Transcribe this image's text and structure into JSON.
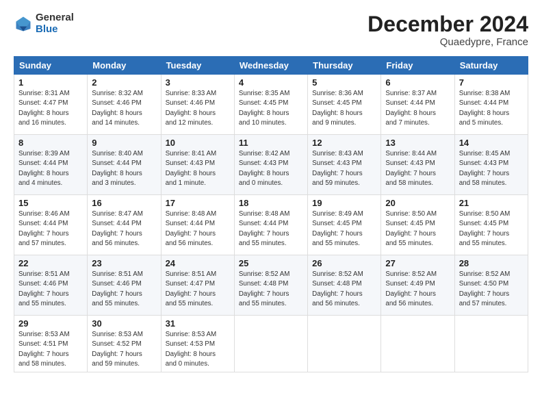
{
  "header": {
    "logo_general": "General",
    "logo_blue": "Blue",
    "month_title": "December 2024",
    "subtitle": "Quaedypre, France"
  },
  "calendar": {
    "days_of_week": [
      "Sunday",
      "Monday",
      "Tuesday",
      "Wednesday",
      "Thursday",
      "Friday",
      "Saturday"
    ],
    "weeks": [
      [
        null,
        null,
        null,
        null,
        null,
        null,
        null
      ]
    ],
    "cells": [
      {
        "day": 1,
        "sunrise": "8:31 AM",
        "sunset": "4:47 PM",
        "daylight": "8 hours and 16 minutes."
      },
      {
        "day": 2,
        "sunrise": "8:32 AM",
        "sunset": "4:46 PM",
        "daylight": "8 hours and 14 minutes."
      },
      {
        "day": 3,
        "sunrise": "8:33 AM",
        "sunset": "4:46 PM",
        "daylight": "8 hours and 12 minutes."
      },
      {
        "day": 4,
        "sunrise": "8:35 AM",
        "sunset": "4:45 PM",
        "daylight": "8 hours and 10 minutes."
      },
      {
        "day": 5,
        "sunrise": "8:36 AM",
        "sunset": "4:45 PM",
        "daylight": "8 hours and 9 minutes."
      },
      {
        "day": 6,
        "sunrise": "8:37 AM",
        "sunset": "4:44 PM",
        "daylight": "8 hours and 7 minutes."
      },
      {
        "day": 7,
        "sunrise": "8:38 AM",
        "sunset": "4:44 PM",
        "daylight": "8 hours and 5 minutes."
      },
      {
        "day": 8,
        "sunrise": "8:39 AM",
        "sunset": "4:44 PM",
        "daylight": "8 hours and 4 minutes."
      },
      {
        "day": 9,
        "sunrise": "8:40 AM",
        "sunset": "4:44 PM",
        "daylight": "8 hours and 3 minutes."
      },
      {
        "day": 10,
        "sunrise": "8:41 AM",
        "sunset": "4:43 PM",
        "daylight": "8 hours and 1 minute."
      },
      {
        "day": 11,
        "sunrise": "8:42 AM",
        "sunset": "4:43 PM",
        "daylight": "8 hours and 0 minutes."
      },
      {
        "day": 12,
        "sunrise": "8:43 AM",
        "sunset": "4:43 PM",
        "daylight": "7 hours and 59 minutes."
      },
      {
        "day": 13,
        "sunrise": "8:44 AM",
        "sunset": "4:43 PM",
        "daylight": "7 hours and 58 minutes."
      },
      {
        "day": 14,
        "sunrise": "8:45 AM",
        "sunset": "4:43 PM",
        "daylight": "7 hours and 58 minutes."
      },
      {
        "day": 15,
        "sunrise": "8:46 AM",
        "sunset": "4:44 PM",
        "daylight": "7 hours and 57 minutes."
      },
      {
        "day": 16,
        "sunrise": "8:47 AM",
        "sunset": "4:44 PM",
        "daylight": "7 hours and 56 minutes."
      },
      {
        "day": 17,
        "sunrise": "8:48 AM",
        "sunset": "4:44 PM",
        "daylight": "7 hours and 56 minutes."
      },
      {
        "day": 18,
        "sunrise": "8:48 AM",
        "sunset": "4:44 PM",
        "daylight": "7 hours and 55 minutes."
      },
      {
        "day": 19,
        "sunrise": "8:49 AM",
        "sunset": "4:45 PM",
        "daylight": "7 hours and 55 minutes."
      },
      {
        "day": 20,
        "sunrise": "8:50 AM",
        "sunset": "4:45 PM",
        "daylight": "7 hours and 55 minutes."
      },
      {
        "day": 21,
        "sunrise": "8:50 AM",
        "sunset": "4:45 PM",
        "daylight": "7 hours and 55 minutes."
      },
      {
        "day": 22,
        "sunrise": "8:51 AM",
        "sunset": "4:46 PM",
        "daylight": "7 hours and 55 minutes."
      },
      {
        "day": 23,
        "sunrise": "8:51 AM",
        "sunset": "4:46 PM",
        "daylight": "7 hours and 55 minutes."
      },
      {
        "day": 24,
        "sunrise": "8:51 AM",
        "sunset": "4:47 PM",
        "daylight": "7 hours and 55 minutes."
      },
      {
        "day": 25,
        "sunrise": "8:52 AM",
        "sunset": "4:48 PM",
        "daylight": "7 hours and 55 minutes."
      },
      {
        "day": 26,
        "sunrise": "8:52 AM",
        "sunset": "4:48 PM",
        "daylight": "7 hours and 56 minutes."
      },
      {
        "day": 27,
        "sunrise": "8:52 AM",
        "sunset": "4:49 PM",
        "daylight": "7 hours and 56 minutes."
      },
      {
        "day": 28,
        "sunrise": "8:52 AM",
        "sunset": "4:50 PM",
        "daylight": "7 hours and 57 minutes."
      },
      {
        "day": 29,
        "sunrise": "8:53 AM",
        "sunset": "4:51 PM",
        "daylight": "7 hours and 58 minutes."
      },
      {
        "day": 30,
        "sunrise": "8:53 AM",
        "sunset": "4:52 PM",
        "daylight": "7 hours and 59 minutes."
      },
      {
        "day": 31,
        "sunrise": "8:53 AM",
        "sunset": "4:53 PM",
        "daylight": "8 hours and 0 minutes."
      }
    ]
  }
}
